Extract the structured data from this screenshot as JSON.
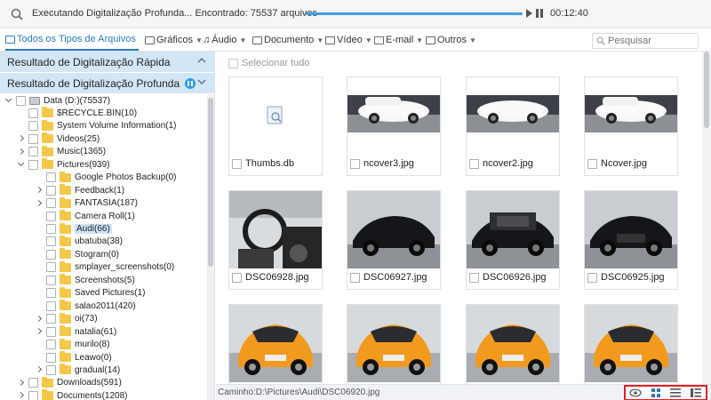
{
  "status": {
    "message": "Executando Digitalização Profunda... Encontrado: 75537 arquivos",
    "progress_fraction": 1.0,
    "elapsed": "00:12:40"
  },
  "filters": {
    "tabs": [
      {
        "label": "Todos os Tipos de Arquivos",
        "icon": "monitor-icon",
        "active": true
      },
      {
        "label": "Gráficos",
        "icon": "image-icon"
      },
      {
        "label": "Áudio",
        "icon": "music-note-icon"
      },
      {
        "label": "Documento",
        "icon": "document-icon"
      },
      {
        "label": "Vídeo",
        "icon": "video-icon"
      },
      {
        "label": "E-mail",
        "icon": "mail-icon"
      },
      {
        "label": "Outros",
        "icon": "folder-icon"
      }
    ],
    "search_placeholder": "Pesquisar"
  },
  "scans": {
    "quick": "Resultado de Digitalização Rápida",
    "deep": "Resultado de Digitalização Profunda"
  },
  "tree": [
    {
      "label": "Data (D:)(75537)",
      "type": "drive"
    },
    {
      "label": "$RECYCLE.BIN(10)"
    },
    {
      "label": "System Volume Information(1)"
    },
    {
      "label": "Videos(25)"
    },
    {
      "label": "Music(1365)"
    },
    {
      "label": "Pictures(939)"
    },
    {
      "label": "Google Photos Backup(0)"
    },
    {
      "label": "Feedback(1)"
    },
    {
      "label": "FANTASIA(187)"
    },
    {
      "label": "Camera Roll(1)"
    },
    {
      "label": "Audi(66)",
      "selected": true
    },
    {
      "label": "ubatuba(38)"
    },
    {
      "label": "Stogram(0)"
    },
    {
      "label": "smplayer_screenshots(0)"
    },
    {
      "label": "Screenshots(5)"
    },
    {
      "label": "Saved Pictures(1)"
    },
    {
      "label": "salao2011(420)"
    },
    {
      "label": "oi(73)"
    },
    {
      "label": "natalia(61)"
    },
    {
      "label": "murilo(8)"
    },
    {
      "label": "Leawo(0)"
    },
    {
      "label": "gradual(14)"
    },
    {
      "label": "Downloads(591)"
    },
    {
      "label": "Documents(1208)"
    }
  ],
  "main": {
    "select_all": "Selecionar tudo",
    "files": [
      {
        "name": "Thumbs.db",
        "kind": "db"
      },
      {
        "name": "ncover3.jpg",
        "kind": "white-cars"
      },
      {
        "name": "ncover2.jpg",
        "kind": "white-car"
      },
      {
        "name": "Ncover.jpg",
        "kind": "white-cars"
      },
      {
        "name": "DSC06928.jpg",
        "kind": "interior"
      },
      {
        "name": "DSC06927.jpg",
        "kind": "black-side"
      },
      {
        "name": "DSC06926.jpg",
        "kind": "black-engine"
      },
      {
        "name": "DSC06925.jpg",
        "kind": "black-front"
      },
      {
        "name": "",
        "kind": "orange-rear"
      },
      {
        "name": "",
        "kind": "orange-rear2"
      },
      {
        "name": "",
        "kind": "orange-side"
      },
      {
        "name": "",
        "kind": "orange-front"
      }
    ]
  },
  "bottom": {
    "path": "Caminho:D:\\Pictures\\Audi\\DSC06920.jpg",
    "view_buttons": [
      "preview-eye-icon",
      "grid-view-icon",
      "list-view-icon",
      "detail-view-icon"
    ]
  },
  "colors": {
    "accent": "#2b79c2",
    "header_bg": "#d3e6f6",
    "highlight": "#e01f26",
    "folder": "#f5c84a"
  }
}
